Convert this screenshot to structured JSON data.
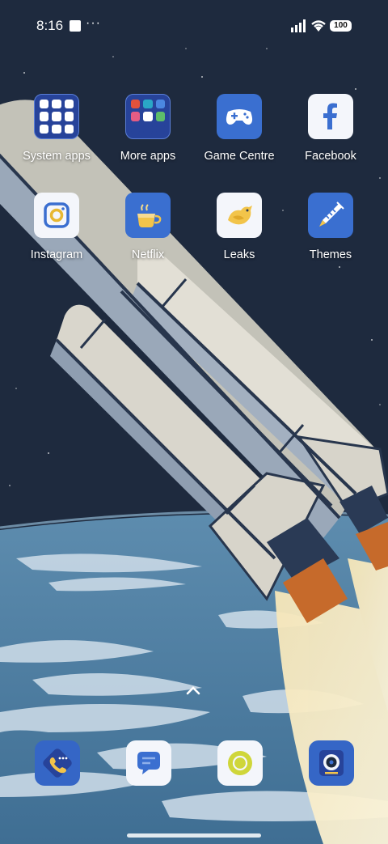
{
  "status_bar": {
    "time": "8:16",
    "notification_more": "···",
    "battery_level": "100",
    "signal_icon": "cellular-signal-icon",
    "wifi_icon": "wifi-icon"
  },
  "home_screen": {
    "apps": [
      {
        "label": "System apps",
        "type": "folder",
        "icon": "folder-icon"
      },
      {
        "label": "More apps",
        "type": "folder",
        "icon": "folder-icon"
      },
      {
        "label": "Game Centre",
        "type": "app",
        "icon": "gamepad-icon"
      },
      {
        "label": "Facebook",
        "type": "app",
        "icon": "facebook-icon"
      },
      {
        "label": "Instagram",
        "type": "app",
        "icon": "instagram-icon"
      },
      {
        "label": "Netflix",
        "type": "app",
        "icon": "coffee-cup-icon"
      },
      {
        "label": "Leaks",
        "type": "app",
        "icon": "bird-icon"
      },
      {
        "label": "Themes",
        "type": "app",
        "icon": "rocket-icon"
      }
    ]
  },
  "dock": {
    "apps": [
      {
        "icon": "phone-icon"
      },
      {
        "icon": "messages-icon"
      },
      {
        "icon": "circle-app-icon"
      },
      {
        "icon": "camera-icon"
      }
    ]
  },
  "colors": {
    "space": "#1e2a3e",
    "earth": "#4f7ea1",
    "clouds": "#c9d9e6",
    "rocket_body": "#d9d6cc",
    "rocket_shadow": "#9aa8b9",
    "flame_orange": "#c66a2b",
    "icon_blue": "#3566c6"
  }
}
